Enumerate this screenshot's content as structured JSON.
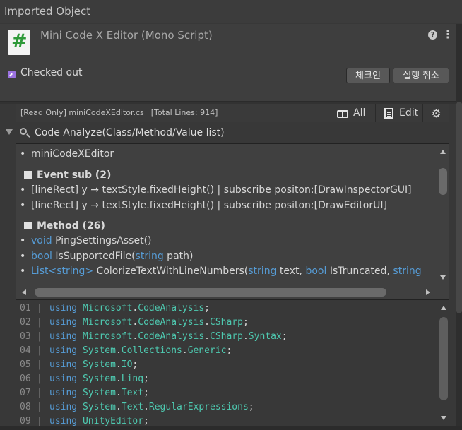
{
  "window": {
    "title": "Imported Object"
  },
  "header": {
    "object_title": "Mini Code X Editor (Mono Script)",
    "icon_glyph": "#",
    "help_glyph": "?",
    "menu_glyph": "⋮",
    "vc_status": "Checked out",
    "checkin_label": "체크인",
    "undo_label": "실행 취소"
  },
  "toolbar": {
    "read_only": "[Read Only] miniCodeXEditor.cs",
    "total_lines": "[Total Lines: 914]",
    "all_label": "All",
    "edit_label": "Edit",
    "gear_glyph": "⚙"
  },
  "analyze": {
    "title": "Code Analyze(Class/Method/Value list)",
    "class_item": "miniCodeXEditor",
    "event_header": "Event sub (2)",
    "events": [
      "[lineRect] y  →  textStyle.fixedHeight() | subscribe positon:[DrawInspectorGUI]",
      "[lineRect] y  →  textStyle.fixedHeight() | subscribe positon:[DrawEditorUI]"
    ],
    "method_header": "Method (26)",
    "methods": [
      {
        "type": "void",
        "rest": " PingSettingsAsset()"
      },
      {
        "type": "bool",
        "rest": " IsSupportedFile(",
        "arg_type": "string",
        "arg_rest": " path)"
      },
      {
        "type": "List<string>",
        "rest": " ColorizeTextWithLineNumbers(",
        "arg_type": "string",
        "arg_rest": " text, ",
        "arg2_type": "bool",
        "arg2_rest": " IsTruncated, ",
        "arg3_type": "string"
      }
    ]
  },
  "code": {
    "lines": [
      {
        "n": "01",
        "kw": "using",
        "ns": [
          [
            "Microsoft",
            "."
          ],
          [
            "CodeAnalysis",
            ";"
          ]
        ]
      },
      {
        "n": "02",
        "kw": "using",
        "ns": [
          [
            "Microsoft",
            "."
          ],
          [
            "CodeAnalysis",
            "."
          ],
          [
            "CSharp",
            ";"
          ]
        ]
      },
      {
        "n": "03",
        "kw": "using",
        "ns": [
          [
            "Microsoft",
            "."
          ],
          [
            "CodeAnalysis",
            "."
          ],
          [
            "CSharp",
            "."
          ],
          [
            "Syntax",
            ";"
          ]
        ]
      },
      {
        "n": "04",
        "kw": "using",
        "ns": [
          [
            "System",
            "."
          ],
          [
            "Collections",
            "."
          ],
          [
            "Generic",
            ";"
          ]
        ]
      },
      {
        "n": "05",
        "kw": "using",
        "ns": [
          [
            "System",
            "."
          ],
          [
            "IO",
            ";"
          ]
        ]
      },
      {
        "n": "06",
        "kw": "using",
        "ns": [
          [
            "System",
            "."
          ],
          [
            "Linq",
            ";"
          ]
        ]
      },
      {
        "n": "07",
        "kw": "using",
        "ns": [
          [
            "System",
            "."
          ],
          [
            "Text",
            ";"
          ]
        ]
      },
      {
        "n": "08",
        "kw": "using",
        "ns": [
          [
            "System",
            "."
          ],
          [
            "Text",
            "."
          ],
          [
            "RegularExpressions",
            ";"
          ]
        ]
      },
      {
        "n": "09",
        "kw": "using",
        "ns": [
          [
            "UnityEditor",
            ";"
          ]
        ]
      }
    ]
  },
  "colors": {
    "keyword": "#569cd6",
    "namespace": "#4ec9b0",
    "vc_icon": "#9b72e0",
    "script_icon": "#2f9a3a"
  }
}
